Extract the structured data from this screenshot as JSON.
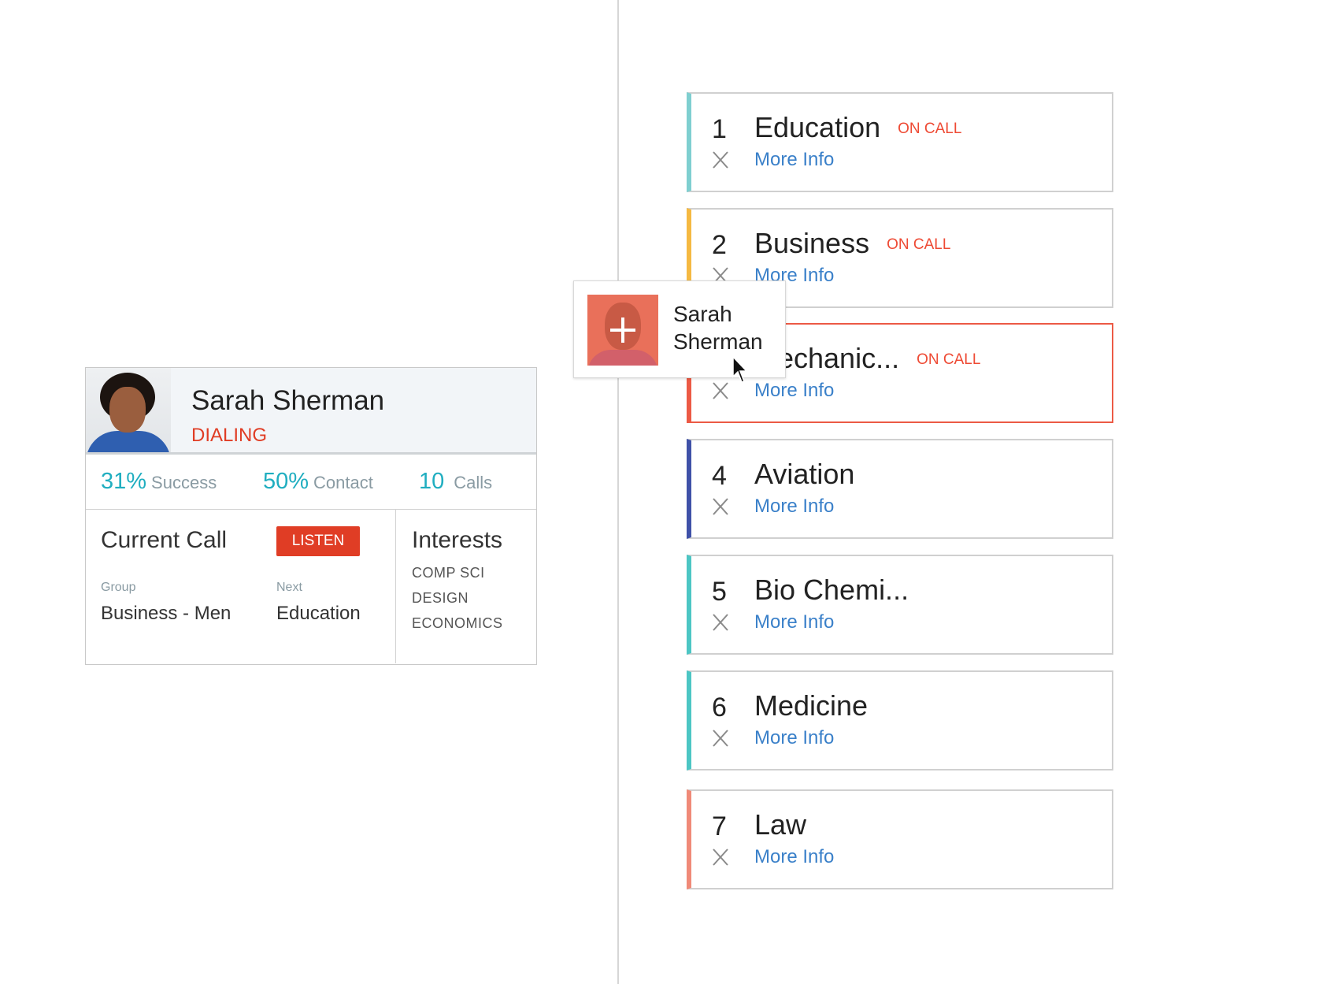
{
  "profile": {
    "name": "Sarah Sherman",
    "status": "DIALING",
    "stats": [
      {
        "value": "31%",
        "label": "Success"
      },
      {
        "value": "50%",
        "label": "Contact"
      },
      {
        "value": "10",
        "label": "Calls"
      }
    ],
    "current_call": {
      "title": "Current Call",
      "listen_label": "LISTEN",
      "group_label": "Group",
      "group_value": "Business - Men",
      "next_label": "Next",
      "next_value": "Education"
    },
    "interests": {
      "title": "Interests",
      "items": [
        "COMP SCI",
        "DESIGN",
        "ECONOMICS"
      ]
    }
  },
  "queue": [
    {
      "num": "1",
      "title": "Education",
      "status": "ON CALL",
      "more": "More Info",
      "color": "#7fcfd0"
    },
    {
      "num": "2",
      "title": "Business",
      "status": "ON CALL",
      "more": "More Info",
      "color": "#f5b942"
    },
    {
      "num": "3",
      "title": "Mechanic...",
      "status": "ON CALL",
      "more": "More Info",
      "color": "#ec5a45"
    },
    {
      "num": "4",
      "title": "Aviation",
      "status": "",
      "more": "More Info",
      "color": "#3f51a8"
    },
    {
      "num": "5",
      "title": "Bio Chemi...",
      "status": "",
      "more": "More Info",
      "color": "#4cc6c4"
    },
    {
      "num": "6",
      "title": "Medicine",
      "status": "",
      "more": "More Info",
      "color": "#4cc6c4"
    },
    {
      "num": "7",
      "title": "Law",
      "status": "",
      "more": "More Info",
      "color": "#f08a78"
    }
  ],
  "drag_chip": {
    "name_line1": "Sarah",
    "name_line2": "Sherman",
    "icon": "plus-icon"
  },
  "colors": {
    "accent": "#20aec0",
    "alert": "#e03d25",
    "link": "#3a80c9"
  }
}
